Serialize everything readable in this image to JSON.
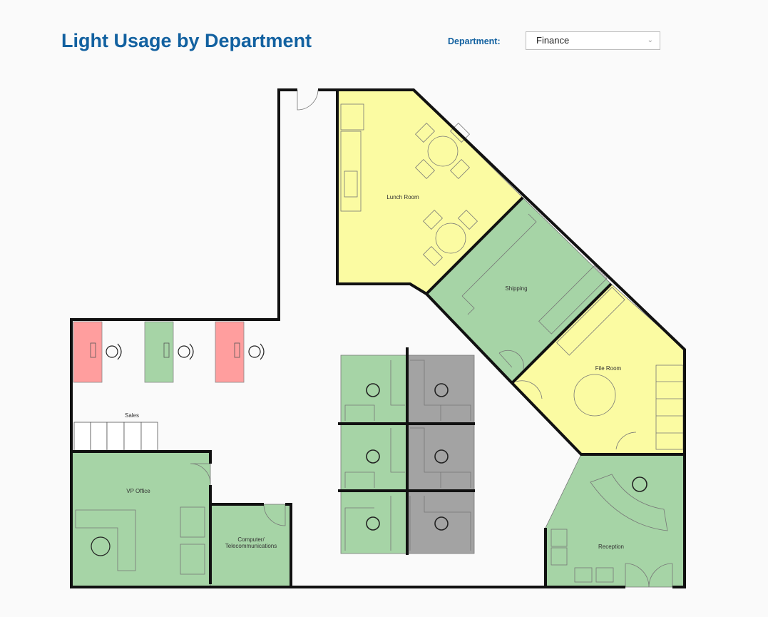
{
  "header": {
    "title": "Light Usage by Department",
    "department_label": "Department:",
    "department_selected": "Finance"
  },
  "colors": {
    "on": "#a6d4a6",
    "partial": "#fbfba2",
    "off": "#ff9e9e",
    "unused": "#a3a3a3",
    "title": "#1261a0"
  },
  "rooms": {
    "lunch": {
      "label": "Lunch Room",
      "status": "partial"
    },
    "shipping": {
      "label": "Shipping",
      "status": "on"
    },
    "file": {
      "label": "File Room",
      "status": "partial"
    },
    "reception": {
      "label": "Reception",
      "status": "on"
    },
    "sales": {
      "label": "Sales"
    },
    "vp": {
      "label": "VP Office",
      "status": "on"
    },
    "computer": {
      "label_line1": "Computer/",
      "label_line2": "Telecommunications",
      "status": "on"
    }
  },
  "sales_desks": [
    "off",
    "on",
    "off"
  ],
  "cubicles": [
    "on",
    "unused",
    "on",
    "unused",
    "on",
    "unused"
  ]
}
